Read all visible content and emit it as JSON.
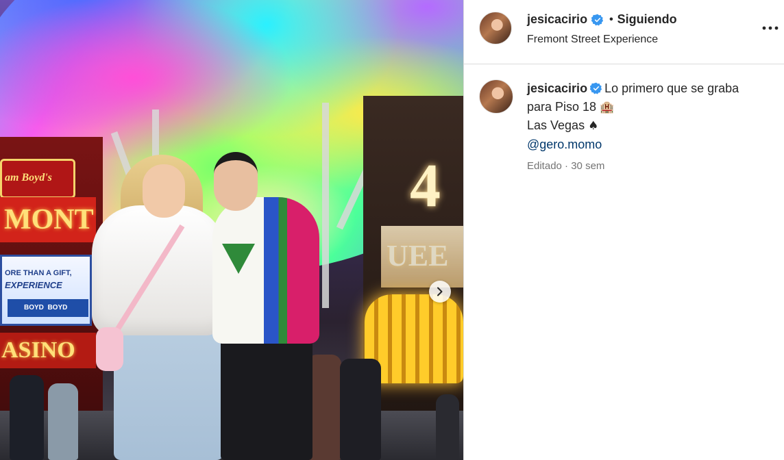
{
  "post": {
    "username": "jesicacirio",
    "follow_state": "Siguiendo",
    "separator": "•",
    "location": "Fremont Street Experience",
    "more_label": "•••"
  },
  "caption": {
    "username": "jesicacirio",
    "line1": "Lo primero que se graba",
    "line2_text": "para Piso 18",
    "line2_emoji": "🏨",
    "line3_text": "Las Vegas",
    "line3_emoji": "♠",
    "mention": "@gero.momo",
    "meta_edited": "Editado",
    "meta_separator": "·",
    "meta_time": "30 sem"
  },
  "photo_signs": {
    "boyds": "am Boyd's",
    "mont": "MONT",
    "billboard_top": "ORE THAN A GIFT,",
    "billboard_mid": "EXPERIENCE",
    "billboard_logos": "BOYD  BOYD",
    "casino": "ASINO",
    "four": "4",
    "queens": "UEE"
  },
  "colors": {
    "verified_blue": "#3897f0",
    "mention_blue": "#00376b",
    "meta_gray": "#737373",
    "divider": "#dbdbdb"
  },
  "icons": {
    "verified": "verified-badge-icon",
    "more": "more-options-icon",
    "next": "chevron-right-icon"
  }
}
